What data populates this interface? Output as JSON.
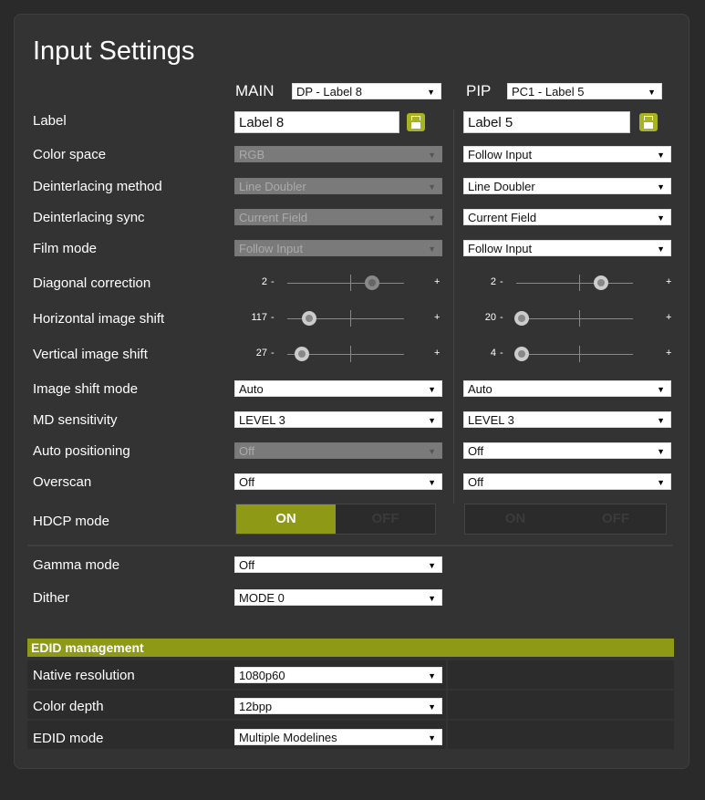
{
  "title": "Input Settings",
  "main": {
    "heading": "MAIN",
    "source": "DP - Label 8",
    "label_value": "Label 8"
  },
  "pip": {
    "heading": "PIP",
    "source": "PC1 - Label 5",
    "label_value": "Label 5"
  },
  "rows": {
    "label": "Label",
    "color_space": "Color space",
    "deint_method": "Deinterlacing method",
    "deint_sync": "Deinterlacing sync",
    "film_mode": "Film mode",
    "diag": "Diagonal correction",
    "hshift": "Horizontal image shift",
    "vshift": "Vertical image shift",
    "shift_mode": "Image shift mode",
    "md": "MD sensitivity",
    "autopos": "Auto positioning",
    "overscan": "Overscan",
    "hdcp": "HDCP mode",
    "gamma": "Gamma mode",
    "dither": "Dither"
  },
  "main_values": {
    "color_space": "RGB",
    "deint_method": "Line Doubler",
    "deint_sync": "Current Field",
    "film_mode": "Follow Input",
    "diag": "2",
    "hshift": "117",
    "vshift": "27",
    "shift_mode": "Auto",
    "md": "LEVEL 3",
    "autopos": "Off",
    "overscan": "Off",
    "gamma": "Off",
    "dither": "MODE 0"
  },
  "pip_values": {
    "color_space": "Follow Input",
    "deint_method": "Line Doubler",
    "deint_sync": "Current Field",
    "film_mode": "Follow Input",
    "diag": "2",
    "hshift": "20",
    "vshift": "4",
    "shift_mode": "Auto",
    "md": "LEVEL 3",
    "autopos": "Off",
    "overscan": "Off"
  },
  "slider_minus": "-",
  "slider_plus": "+",
  "toggle": {
    "on": "ON",
    "off": "OFF"
  },
  "edid": {
    "header": "EDID management",
    "native_label": "Native resolution",
    "native_value": "1080p60",
    "depth_label": "Color depth",
    "depth_value": "12bpp",
    "mode_label": "EDID mode",
    "mode_value": "Multiple Modelines"
  },
  "colors": {
    "accent": "#8e9a15",
    "panel": "#333333",
    "background": "#2a2a2a"
  }
}
